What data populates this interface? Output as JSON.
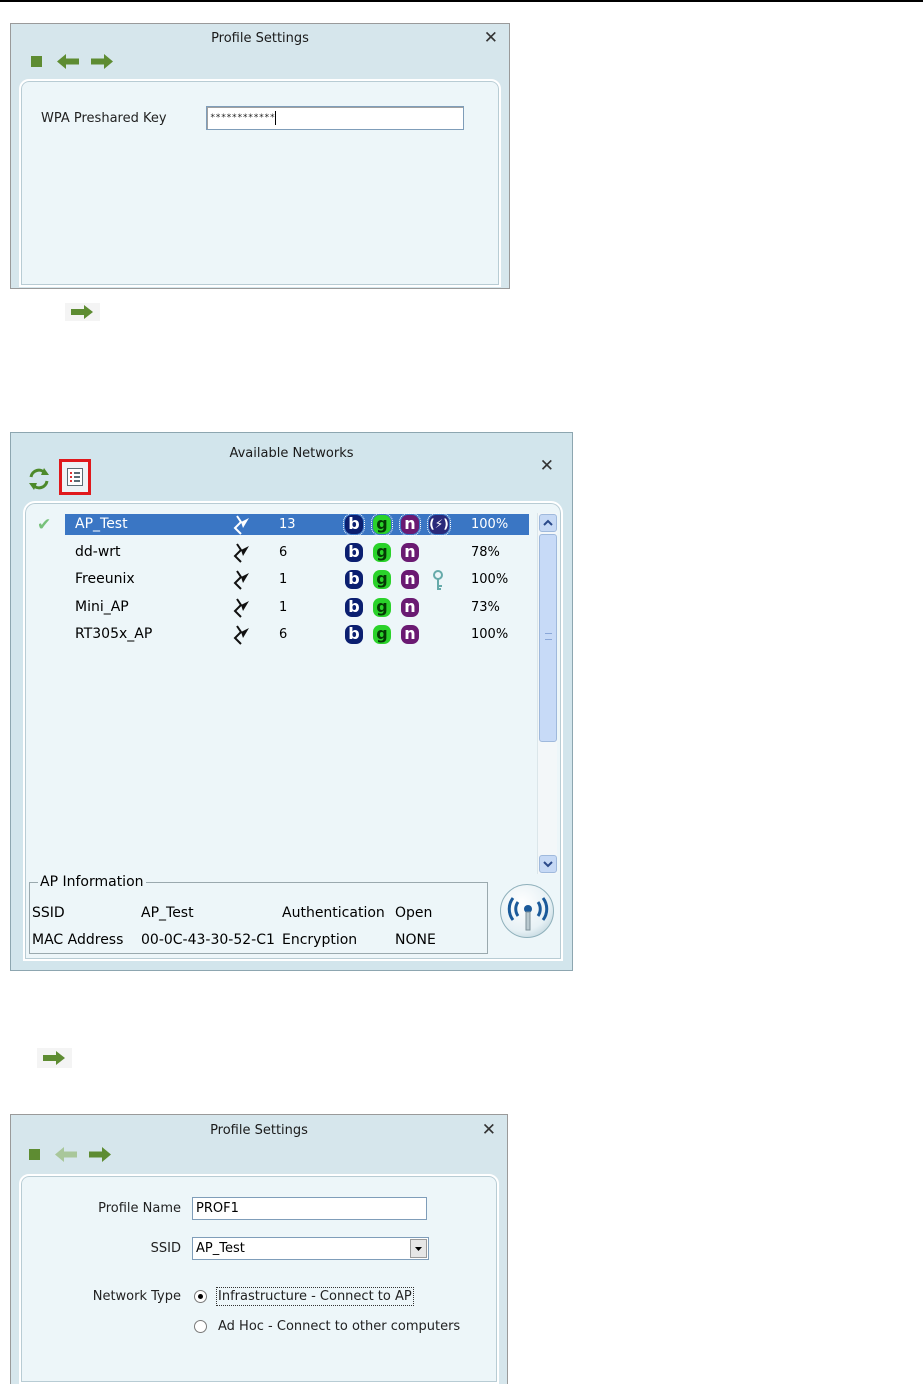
{
  "colors": {
    "window_bg": "#d6e6ec",
    "panel_bg": "#edf6f9",
    "toolbar_green": "#5e8c32",
    "selection_blue": "#3a76c4",
    "highlight_red": "#e0191c"
  },
  "profile_settings_key": {
    "title": "Profile Settings",
    "close": "✕",
    "toolbar": [
      "stop-icon",
      "back-arrow-icon",
      "forward-arrow-icon"
    ],
    "wpa_label": "WPA Preshared Key",
    "wpa_value": "************"
  },
  "next_arrow_1": "forward-arrow-icon",
  "available_networks": {
    "title": "Available Networks",
    "close": "✕",
    "toolbar": [
      "refresh-icon",
      "list-view-icon"
    ],
    "networks": [
      {
        "ssid": "AP_Test",
        "channel": "13",
        "signal": "100%",
        "selected": true,
        "connected": true,
        "wps": true,
        "secured": false
      },
      {
        "ssid": "dd-wrt",
        "channel": "6",
        "signal": "78%",
        "selected": false,
        "connected": false,
        "wps": false,
        "secured": false
      },
      {
        "ssid": "Freeunix",
        "channel": "1",
        "signal": "100%",
        "selected": false,
        "connected": false,
        "wps": false,
        "secured": true
      },
      {
        "ssid": "Mini_AP",
        "channel": "1",
        "signal": "73%",
        "selected": false,
        "connected": false,
        "wps": false,
        "secured": false
      },
      {
        "ssid": "RT305x_AP",
        "channel": "6",
        "signal": "100%",
        "selected": false,
        "connected": false,
        "wps": false,
        "secured": false
      }
    ],
    "badges": {
      "b": "b",
      "g": "g",
      "n": "n",
      "wps": "(⚡)"
    },
    "ap_info": {
      "legend": "AP Information",
      "ssid_label": "SSID",
      "ssid_value": "AP_Test",
      "mac_label": "MAC Address",
      "mac_value": "00-0C-43-30-52-C1",
      "auth_label": "Authentication",
      "auth_value": "Open",
      "enc_label": "Encryption",
      "enc_value": "NONE"
    },
    "connect_icon": "antenna-connect-icon"
  },
  "next_arrow_2": "forward-arrow-icon",
  "profile_settings_general": {
    "title": "Profile Settings",
    "close": "✕",
    "toolbar": [
      "stop-icon",
      "back-arrow-icon-disabled",
      "forward-arrow-icon"
    ],
    "profile_name_label": "Profile Name",
    "profile_name_value": "PROF1",
    "ssid_label": "SSID",
    "ssid_value": "AP_Test",
    "network_type_label": "Network Type",
    "option_infrastructure": "Infrastructure - Connect to AP",
    "option_adhoc": "Ad Hoc - Connect to other computers",
    "selected_option": "infrastructure"
  }
}
